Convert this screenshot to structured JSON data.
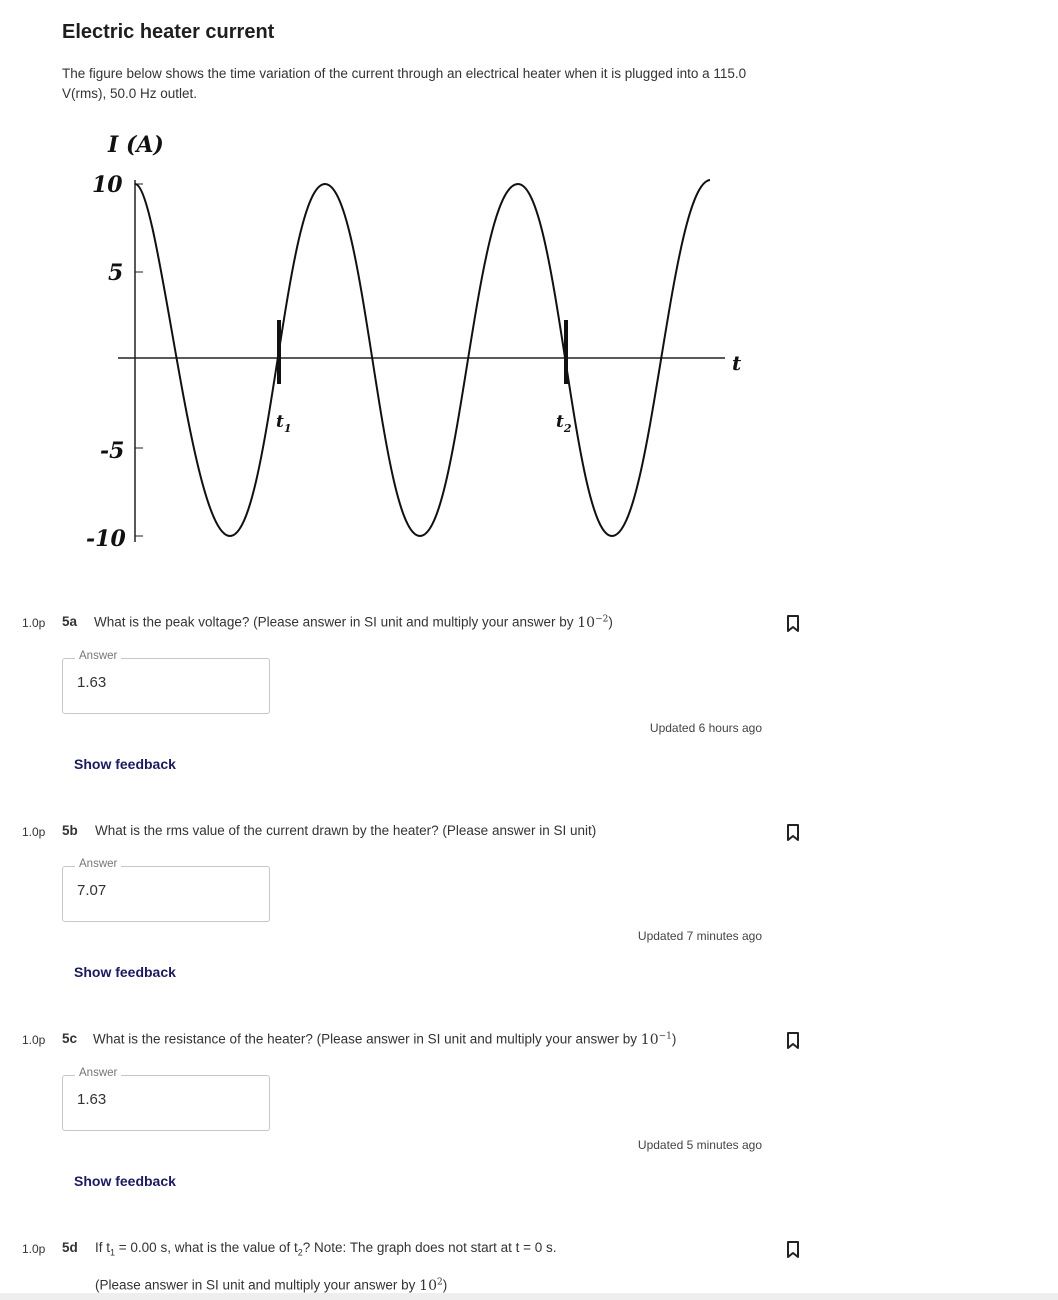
{
  "page": {
    "title": "Electric heater current",
    "intro": "The figure below shows the time variation of the current through an electrical heater when it is plugged into a 115.0 V(rms), 50.0 Hz outlet."
  },
  "figure": {
    "y_axis_label": "I (A)",
    "x_axis_label": "t",
    "y_ticks": [
      "10",
      "5",
      "-5",
      "-10"
    ],
    "marker_t1": "t",
    "marker_t1_sub": "1",
    "marker_t2": "t",
    "marker_t2_sub": "2"
  },
  "questions": [
    {
      "points": "1.0p",
      "number": "5a",
      "text": "What is the peak voltage? (Please answer in SI unit and multiply your answer by ",
      "math_base": "10",
      "math_exp": "−2",
      "text_end": ")",
      "answer_label": "Answer",
      "answer_value": "1.63",
      "updated": "Updated 6 hours ago",
      "feedback": "Show feedback"
    },
    {
      "points": "1.0p",
      "number": "5b",
      "text": "What is the rms value of the current drawn by the heater? (Please answer in SI unit)",
      "answer_label": "Answer",
      "answer_value": "7.07",
      "updated": "Updated 7 minutes ago",
      "feedback": "Show feedback"
    },
    {
      "points": "1.0p",
      "number": "5c",
      "text": "What is the resistance of the heater?  (Please answer in SI unit and multiply your answer by ",
      "math_base": "10",
      "math_exp": "−1",
      "text_end": ")",
      "answer_label": "Answer",
      "answer_value": "1.63",
      "updated": "Updated 5 minutes ago",
      "feedback": "Show feedback"
    },
    {
      "points": "1.0p",
      "number": "5d",
      "text_a": "If t",
      "sub_a": "1",
      "text_b": " = 0.00 s, what is the value of t",
      "sub_b": "2",
      "text_c": "? Note: The graph does not start at t = 0 s.",
      "line2": "(Please answer in SI unit and multiply your answer by ",
      "math_base": "10",
      "math_exp": "2",
      "text_end": ")"
    }
  ],
  "icons": {
    "bookmark": "bookmark-icon"
  }
}
